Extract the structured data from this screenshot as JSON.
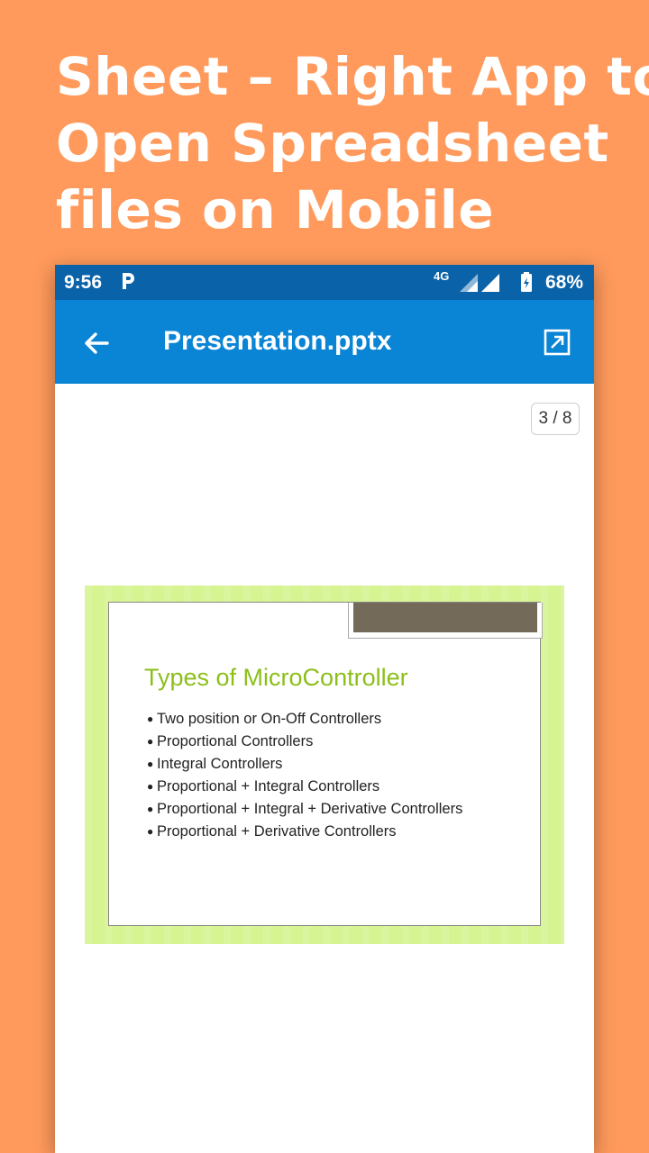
{
  "promo": {
    "line1": "Sheet – Right App to",
    "line2": "Open Spreadsheet",
    "line3": "files on Mobile"
  },
  "statusbar": {
    "time": "9:56",
    "notification": "P",
    "network": "4G",
    "battery": "68%"
  },
  "appbar": {
    "title": "Presentation.pptx",
    "back_icon": "arrow-left-icon",
    "open_icon": "open-external-icon"
  },
  "viewer": {
    "page_indicator": "3 / 8"
  },
  "slide": {
    "title": "Types of MicroController",
    "bullets": [
      "Two position or On-Off Controllers",
      "Proportional Controllers",
      "Integral Controllers",
      "Proportional + Integral Controllers",
      "Proportional + Integral + Derivative Controllers",
      "Proportional + Derivative Controllers"
    ]
  },
  "colors": {
    "background": "#FF9A5C",
    "statusbar": "#0A62A8",
    "appbar": "#0A84D4",
    "slide_frame": "#D7F493",
    "slide_title": "#8CBF1A"
  }
}
